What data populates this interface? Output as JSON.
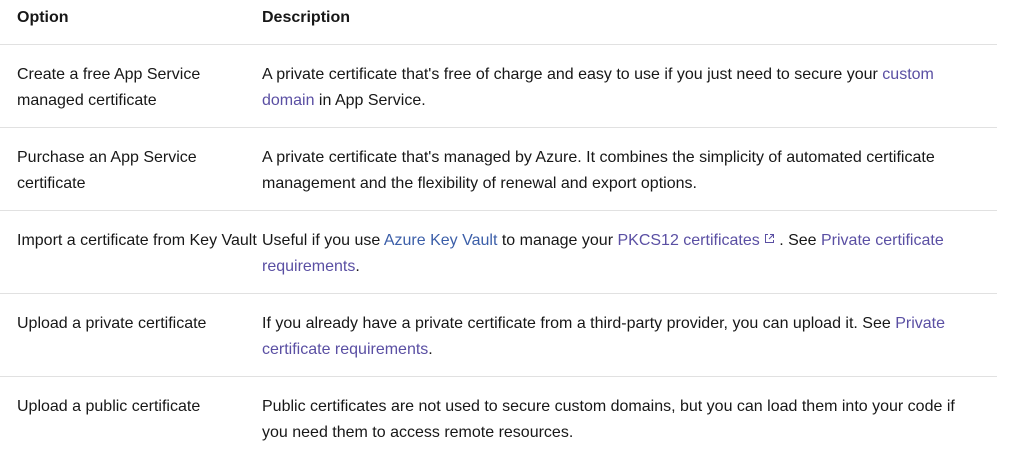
{
  "table": {
    "headers": {
      "option": "Option",
      "description": "Description"
    },
    "rows": [
      {
        "option": "Create a free App Service managed certificate",
        "desc_before": "A private certificate that's free of charge and easy to use if you just need to secure your ",
        "link1": "custom domain",
        "desc_after": " in App Service."
      },
      {
        "option": "Purchase an App Service certificate",
        "desc": "A private certificate that's managed by Azure. It combines the simplicity of automated certificate management and the flexibility of renewal and export options."
      },
      {
        "option": "Import a certificate from Key Vault",
        "desc_before": "Useful if you use ",
        "link1": "Azure Key Vault",
        "desc_mid1": " to manage your ",
        "link2": "PKCS12 certificates",
        "desc_mid2": " . See ",
        "link3": "Private certificate requirements",
        "desc_after": "."
      },
      {
        "option": "Upload a private certificate",
        "desc_before": "If you already have a private certificate from a third-party provider, you can upload it. See ",
        "link1": "Private certificate requirements",
        "desc_after": "."
      },
      {
        "option": "Upload a public certificate",
        "desc": "Public certificates are not used to secure custom domains, but you can load them into your code if you need them to access remote resources."
      }
    ]
  },
  "icons": {
    "external_link": "external-link-icon"
  },
  "colors": {
    "link": "#5a4fa3",
    "link_azure": "#3b5ea8",
    "border": "#e1e1e1",
    "text": "#171717"
  }
}
